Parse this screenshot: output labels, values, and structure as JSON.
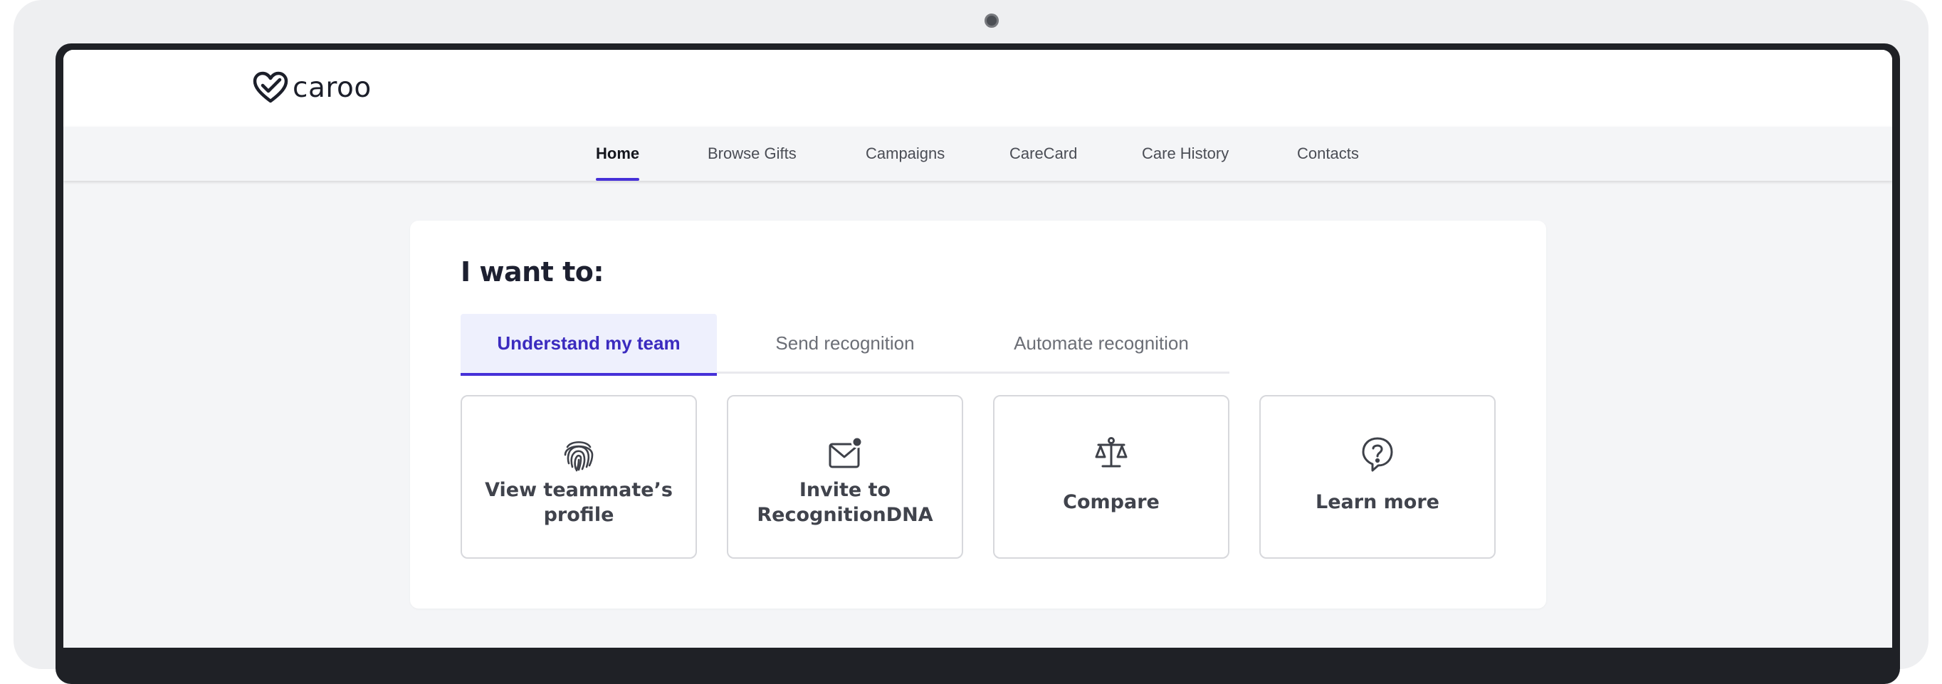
{
  "brand": {
    "name": "caroo",
    "accent_color": "#4630d8",
    "logo_icon": "heart-check-icon"
  },
  "nav": {
    "items": [
      {
        "label": "Home",
        "active": true
      },
      {
        "label": "Browse Gifts",
        "active": false
      },
      {
        "label": "Campaigns",
        "active": false
      },
      {
        "label": "CareCard",
        "active": false
      },
      {
        "label": "Care History",
        "active": false
      },
      {
        "label": "Contacts",
        "active": false
      }
    ]
  },
  "card": {
    "title": "I want to:",
    "tabs": [
      {
        "label": "Understand my team",
        "active": true
      },
      {
        "label": "Send recognition",
        "active": false
      },
      {
        "label": "Automate recognition",
        "active": false
      }
    ],
    "tiles": [
      {
        "label": "View teammate’s profile",
        "icon": "fingerprint-icon"
      },
      {
        "label": "Invite to RecognitionDNA",
        "icon": "mail-notification-icon"
      },
      {
        "label": "Compare",
        "icon": "balance-scale-icon"
      },
      {
        "label": "Learn more",
        "icon": "question-bubble-icon"
      }
    ]
  }
}
